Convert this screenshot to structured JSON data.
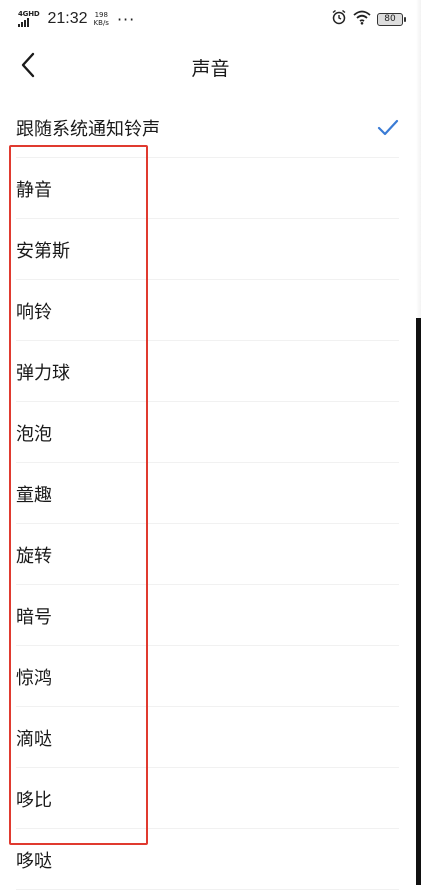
{
  "status_bar": {
    "network_type": "4GHD",
    "time": "21:32",
    "net_speed_value": "198",
    "net_speed_unit": "KB/s",
    "more": "···",
    "battery": "80",
    "icons": [
      "signal-icon",
      "alarm-icon",
      "wifi-icon",
      "battery-icon"
    ]
  },
  "header": {
    "back_icon": "chevron-left-icon",
    "title": "声音"
  },
  "sounds": {
    "items": [
      {
        "label": "跟随系统通知铃声",
        "selected": true
      },
      {
        "label": "静音",
        "selected": false
      },
      {
        "label": "安第斯",
        "selected": false
      },
      {
        "label": "响铃",
        "selected": false
      },
      {
        "label": "弹力球",
        "selected": false
      },
      {
        "label": "泡泡",
        "selected": false
      },
      {
        "label": "童趣",
        "selected": false
      },
      {
        "label": "旋转",
        "selected": false
      },
      {
        "label": "暗号",
        "selected": false
      },
      {
        "label": "惊鸿",
        "selected": false
      },
      {
        "label": "滴哒",
        "selected": false
      },
      {
        "label": "哆比",
        "selected": false
      },
      {
        "label": "哆哒",
        "selected": false
      }
    ]
  },
  "colors": {
    "check": "#3a7bd5",
    "highlight_border": "#e03a2f",
    "text": "#1a1a1a",
    "divider": "#f1f1f1"
  }
}
